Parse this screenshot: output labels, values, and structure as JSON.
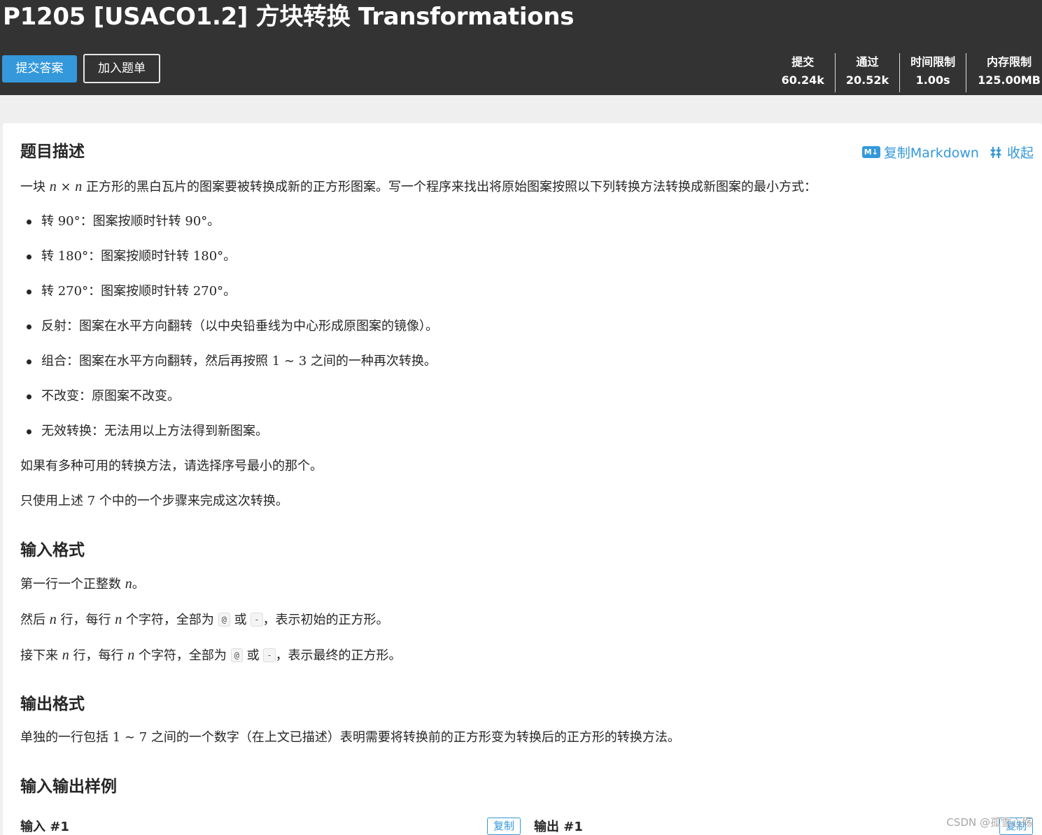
{
  "header": {
    "title": "P1205 [USACO1.2] 方块转换 Transformations",
    "submit_label": "提交答案",
    "add_label": "加入题单",
    "stats": [
      {
        "label": "提交",
        "value": "60.24k"
      },
      {
        "label": "通过",
        "value": "20.52k"
      },
      {
        "label": "时间限制",
        "value": "1.00s"
      },
      {
        "label": "内存限制",
        "value": "125.00MB"
      }
    ]
  },
  "toolbar": {
    "md_icon": "M↓",
    "copy_markdown": "复制Markdown",
    "collapse": "收起"
  },
  "description": {
    "heading": "题目描述",
    "intro": {
      "a": "一块 ",
      "n1": "n",
      "times": " × ",
      "n2": "n",
      "b": " 正方形的黑白瓦片的图案要被转换成新的正方形图案。写一个程序来找出将原始图案按照以下列转换方法转换成新图案的最小方式："
    },
    "items": [
      {
        "pre": "转 ",
        "m1": "90°",
        "mid": "：图案按顺时针转 ",
        "m2": "90°",
        "post": "。"
      },
      {
        "pre": "转 ",
        "m1": "180°",
        "mid": "：图案按顺时针转 ",
        "m2": "180°",
        "post": "。"
      },
      {
        "pre": "转 ",
        "m1": "270°",
        "mid": "：图案按顺时针转 ",
        "m2": "270°",
        "post": "。"
      },
      {
        "pre": "反射：图案在水平方向翻转（以中央铅垂线为中心形成原图案的镜像）。",
        "m1": "",
        "mid": "",
        "m2": "",
        "post": ""
      },
      {
        "pre": "组合：图案在水平方向翻转，然后再按照 ",
        "m1": "1 ∼ 3",
        "mid": " 之间的一种再次转换。",
        "m2": "",
        "post": ""
      },
      {
        "pre": "不改变：原图案不改变。",
        "m1": "",
        "mid": "",
        "m2": "",
        "post": ""
      },
      {
        "pre": "无效转换：无法用以上方法得到新图案。",
        "m1": "",
        "mid": "",
        "m2": "",
        "post": ""
      }
    ],
    "note1": "如果有多种可用的转换方法，请选择序号最小的那个。",
    "note2": {
      "a": "只使用上述 ",
      "num": "7",
      "b": " 个中的一个步骤来完成这次转换。"
    }
  },
  "input_format": {
    "heading": "输入格式",
    "line1": {
      "a": "第一行一个正整数 ",
      "n": "n",
      "b": "。"
    },
    "line2": {
      "a": "然后 ",
      "n1": "n",
      "b": " 行，每行 ",
      "n2": "n",
      "c": " 个字符，全部为 ",
      "code1": "@",
      "d": " 或 ",
      "code2": "-",
      "e": "，表示初始的正方形。"
    },
    "line3": {
      "a": "接下来 ",
      "n1": "n",
      "b": " 行，每行 ",
      "n2": "n",
      "c": " 个字符，全部为 ",
      "code1": "@",
      "d": " 或 ",
      "code2": "-",
      "e": "，表示最终的正方形。"
    }
  },
  "output_format": {
    "heading": "输出格式",
    "line": {
      "a": "单独的一行包括 ",
      "m": "1 ∼ 7",
      "b": " 之间的一个数字（在上文已描述）表明需要将转换前的正方形变为转换后的正方形的转换方法。"
    }
  },
  "samples": {
    "heading": "输入输出样例",
    "input_label": "输入 #1",
    "output_label": "输出 #1",
    "copy_label": "复制"
  },
  "watermark": "CSDN @孤雪心殇"
}
